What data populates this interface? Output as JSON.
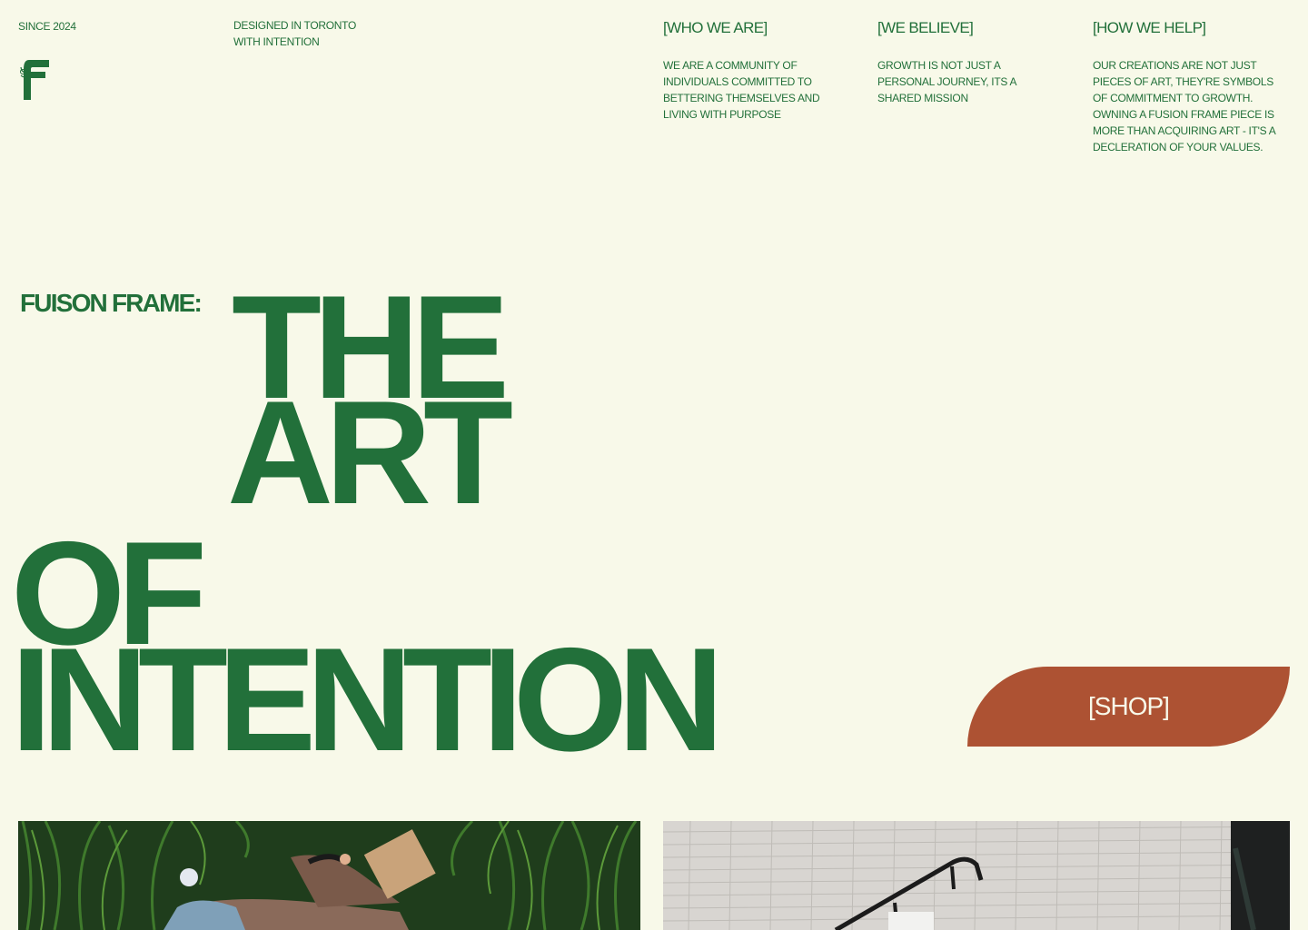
{
  "header": {
    "since": "SINCE 2024",
    "designed_line1": "DESIGNED IN TORONTO",
    "designed_line2": "WITH INTENTION"
  },
  "columns": [
    {
      "title": "[WHO WE ARE]",
      "body": "WE ARE A COMMUNITY OF INDIVIDUALS COMMITTED TO BETTERING THEMSELVES AND LIVING WITH PURPOSE"
    },
    {
      "title": "[WE BELIEVE]",
      "body": "GROWTH IS NOT JUST A PERSONAL JOURNEY, ITS A SHARED MISSION"
    },
    {
      "title": "[HOW WE HELP]",
      "body": "OUR CREATIONS ARE NOT JUST PIECES OF ART, THEY'RE SYMBOLS OF COMMITMENT TO GROWTH. OWNING A FUSION FRAME PIECE IS MORE THAN ACQUIRING ART - IT'S A DECLERATION OF YOUR VALUES."
    }
  ],
  "hero": {
    "brand_label": "FUISON FRAME:",
    "word1": "THE",
    "word2": "ART",
    "word3": "OF",
    "word4": "INTENTION"
  },
  "shop_label": "[SHOP]",
  "colors": {
    "background": "#f8f9e9",
    "brand_green": "#22703a",
    "accent_rust": "#ad5233"
  },
  "icons": {
    "logo": "fusion-frame-logo-icon"
  }
}
